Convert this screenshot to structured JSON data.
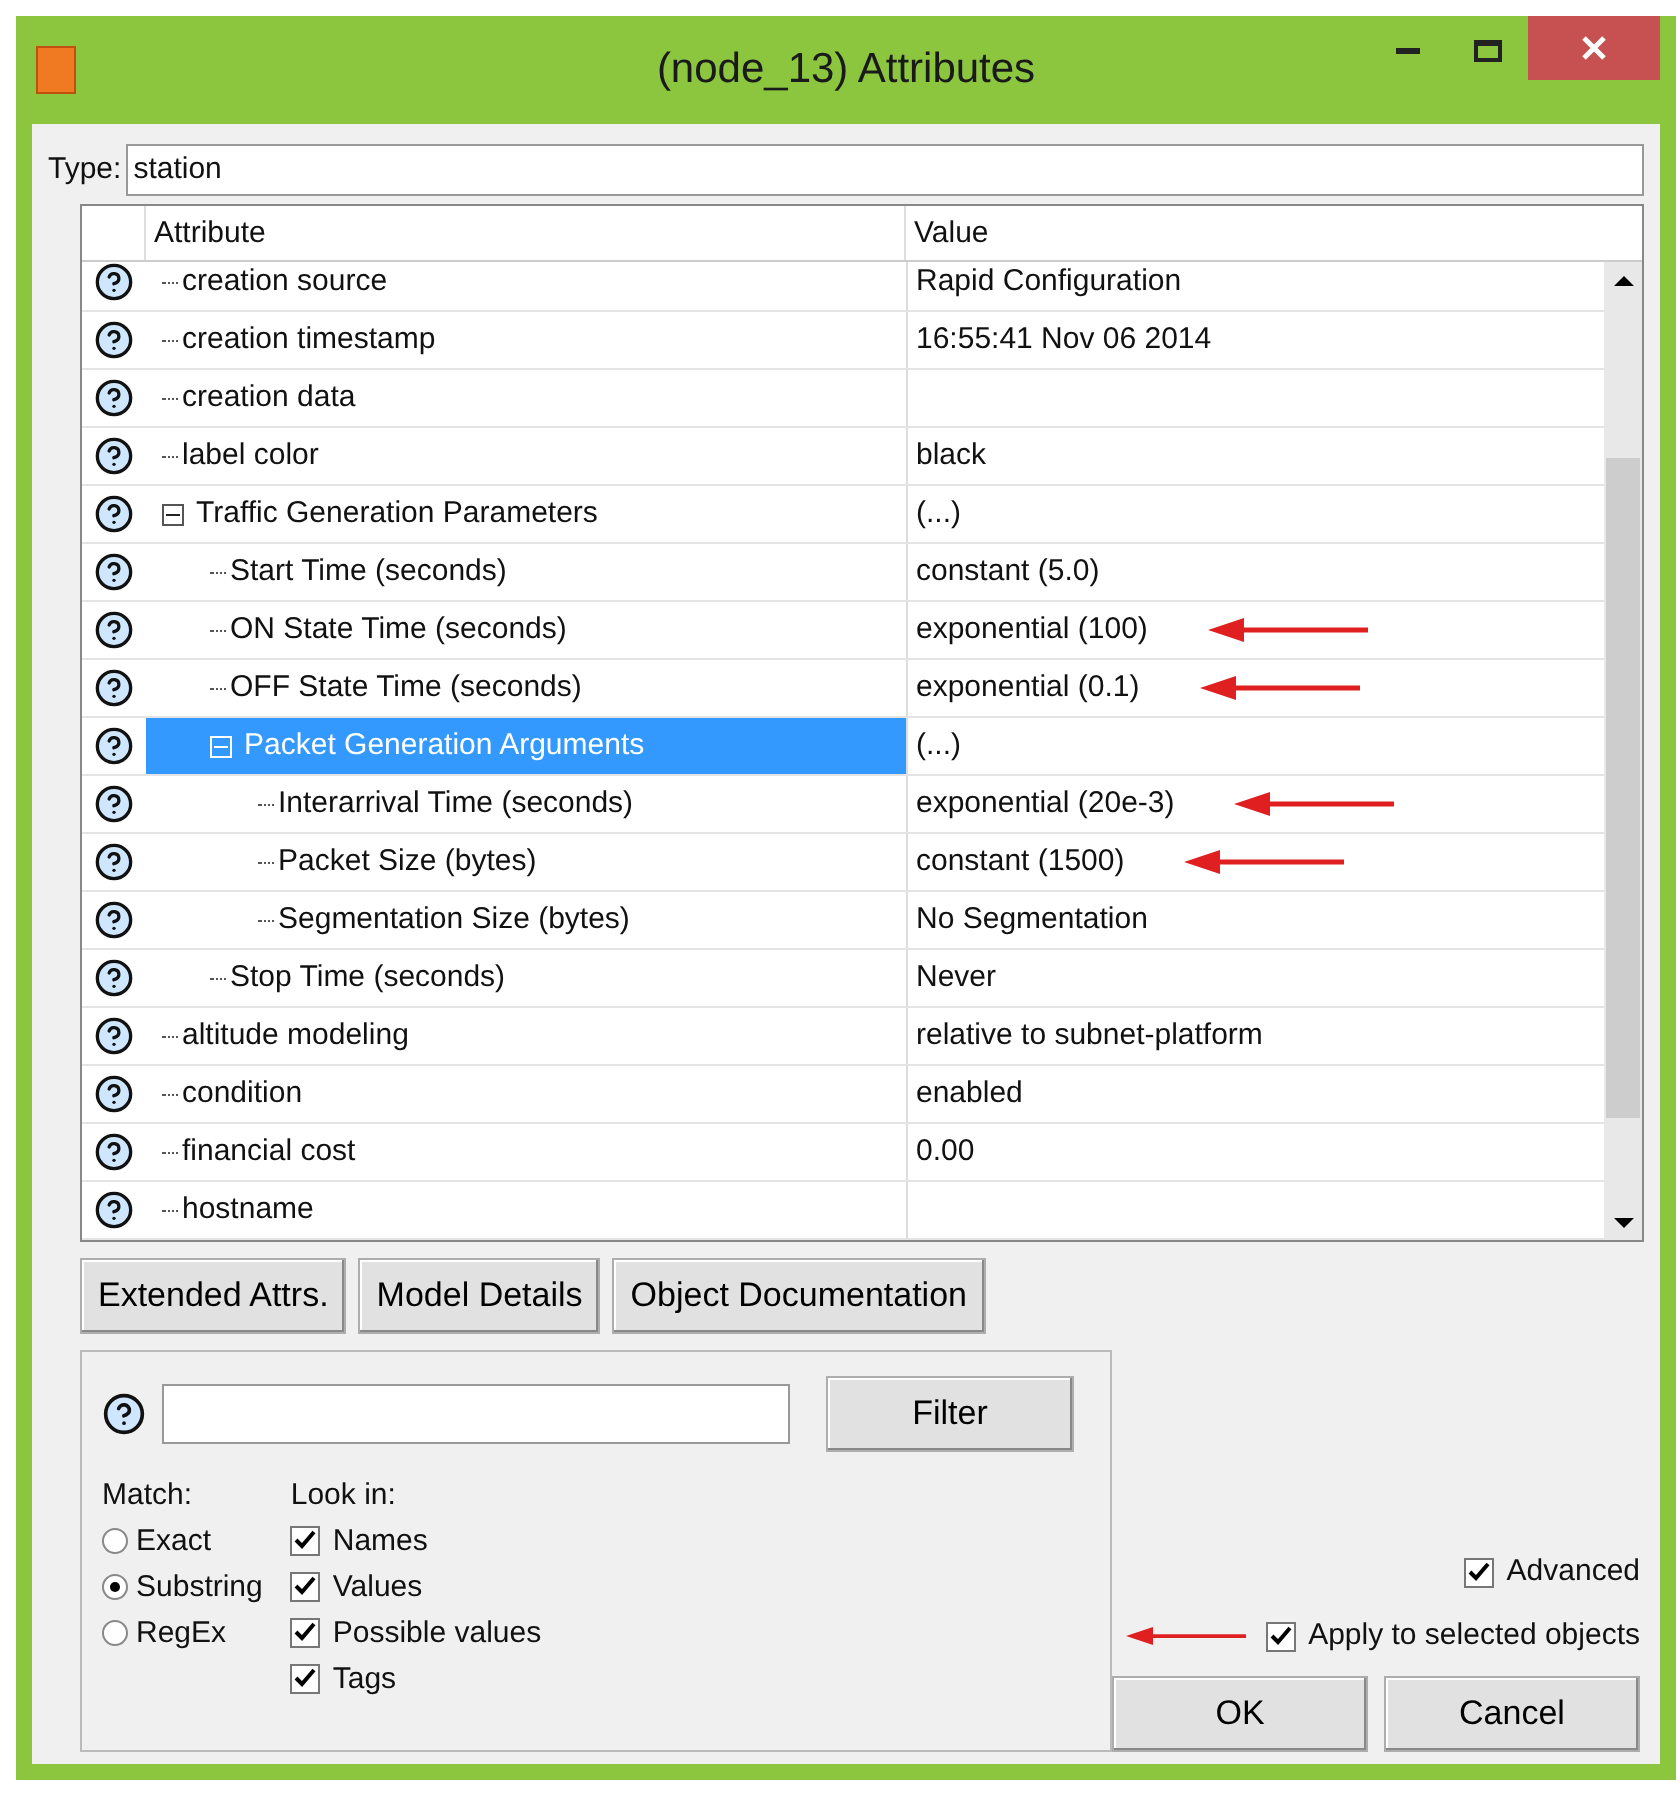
{
  "window": {
    "title": "(node_13) Attributes"
  },
  "type_field": {
    "label": "Type:",
    "value": "station"
  },
  "table": {
    "columns": [
      "Attribute",
      "Value"
    ],
    "rows": [
      {
        "name": "creation source",
        "value": "Rapid Configuration",
        "selected": false,
        "marked": false
      },
      {
        "name": "creation timestamp",
        "value": "16:55:41 Nov 06 2014",
        "selected": false,
        "marked": false
      },
      {
        "name": "creation data",
        "selected": false,
        "marked": false
      },
      {
        "name": "label color",
        "value": "black",
        "selected": false,
        "marked": false
      },
      {
        "name": "Traffic Generation Parameters",
        "value": "(...)",
        "selected": false,
        "marked": false,
        "expanded": true,
        "children": [
          {
            "name": "Start Time (seconds)",
            "value": "constant (5.0)",
            "selected": false,
            "marked": false
          },
          {
            "name": "ON State Time (seconds)",
            "value": "exponential (100)",
            "selected": false,
            "marked": true
          },
          {
            "name": "OFF State Time (seconds)",
            "value": "exponential (0.1)",
            "selected": false,
            "marked": true
          },
          {
            "name": "Packet Generation Arguments",
            "value": "(...)",
            "selected": true,
            "marked": false,
            "expanded": true,
            "children": [
              {
                "name": "Interarrival Time (seconds)",
                "value": "exponential (20e-3)",
                "selected": false,
                "marked": true
              },
              {
                "name": "Packet Size (bytes)",
                "value": "constant (1500)",
                "selected": false,
                "marked": true
              },
              {
                "name": "Segmentation Size (bytes)",
                "value": "No Segmentation",
                "selected": false,
                "marked": false
              }
            ]
          },
          {
            "name": "Stop Time (seconds)",
            "value": "Never",
            "selected": false,
            "marked": false
          }
        ]
      },
      {
        "name": "altitude modeling",
        "value": "relative to subnet-platform",
        "selected": false,
        "marked": false
      },
      {
        "name": "condition",
        "value": "enabled",
        "selected": false,
        "marked": false
      },
      {
        "name": "financial cost",
        "value": "0.00",
        "selected": false,
        "marked": false
      },
      {
        "name": "hostname",
        "selected": false,
        "marked": false
      }
    ]
  },
  "buttons": [
    "Extended Attrs.",
    "Model Details",
    "Object Documentation"
  ],
  "filter": {
    "button": "Filter",
    "match_label": "Match:",
    "match": [
      {
        "label": "Exact",
        "selected": false
      },
      {
        "label": "Substring",
        "selected": true
      },
      {
        "label": "RegEx",
        "selected": false
      }
    ],
    "look_in_label": "Look in:",
    "look_in": [
      {
        "label": "Names",
        "checked": true
      },
      {
        "label": "Values",
        "checked": true
      },
      {
        "label": "Possible values",
        "checked": true
      },
      {
        "label": "Tags",
        "checked": true
      }
    ]
  },
  "options": [
    {
      "label": "Advanced",
      "checked": true,
      "marked": false
    },
    {
      "label": "Apply to selected objects",
      "checked": true,
      "marked": true
    }
  ],
  "dialog_buttons": [
    "OK",
    "Cancel"
  ]
}
